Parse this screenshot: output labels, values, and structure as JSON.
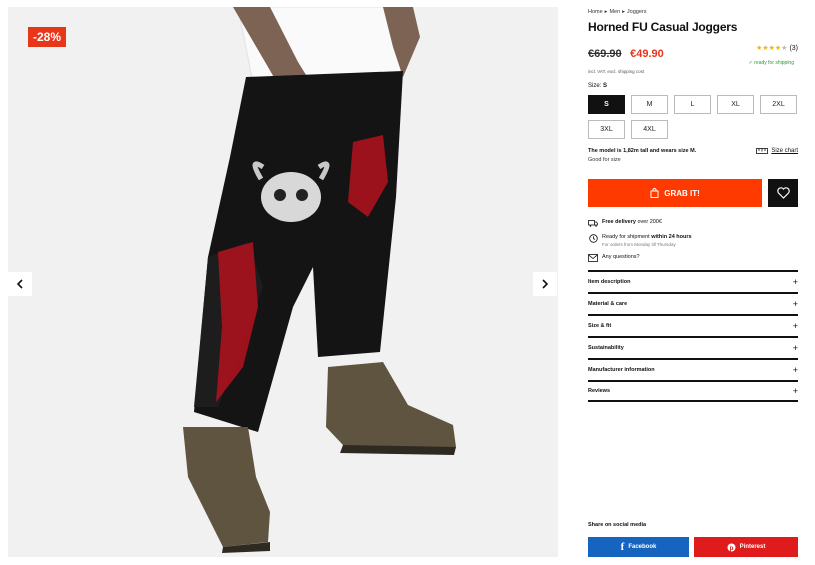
{
  "gallery": {
    "discount_badge": "-28%",
    "prev_icon": "chevron-left-icon",
    "next_icon": "chevron-right-icon"
  },
  "breadcrumb": {
    "items": [
      "Home",
      "Men",
      "Joggers"
    ],
    "separator_icon": "caret-right-icon"
  },
  "product": {
    "title": "Horned FU Casual Joggers",
    "old_price": "€69.90",
    "new_price": "€49.90",
    "vat_note": "incl. VAT, excl. shipping cost",
    "rating_value": 4,
    "rating_max": 5,
    "rating_count": "(3)",
    "ready_text": "✓ ready for shipping"
  },
  "size": {
    "label": "Size:",
    "selected": "S",
    "options": [
      "S",
      "M",
      "L",
      "XL",
      "2XL",
      "3XL",
      "4XL"
    ]
  },
  "model": {
    "text": "The model is 1,82m tall and wears size M.",
    "fit": "Good for size",
    "size_chart": "Size chart"
  },
  "actions": {
    "grab_label": "GRAB IT!",
    "wishlist_icon": "heart-icon"
  },
  "perks": {
    "delivery_bold": "Free delivery",
    "delivery_rest": " over 200€",
    "shipment_pre": "Ready for shipment ",
    "shipment_bold": "within 24 hours",
    "shipment_sub": "For orders from Monday till Thursday",
    "questions": "Any questions?"
  },
  "accordion": [
    "Item description",
    "Material & care",
    "Size & fit",
    "Sustainability",
    "Manufacturer information",
    "Reviews"
  ],
  "share": {
    "label": "Share on social media",
    "facebook": "Facebook",
    "pinterest": "Pinterest"
  },
  "colors": {
    "accent": "#ff3a00",
    "discount": "#e8361a",
    "facebook": "#1565c0",
    "pinterest": "#e01b1b"
  }
}
